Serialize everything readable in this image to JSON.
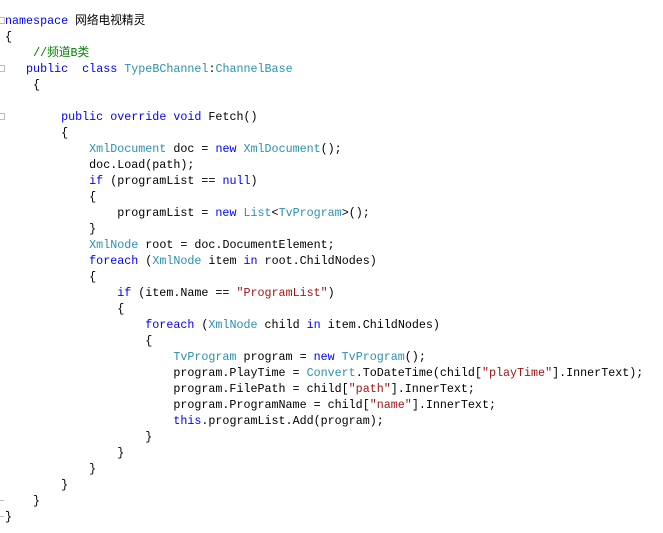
{
  "colors": {
    "keyword": "#0000ff",
    "type": "#2b91af",
    "string": "#a31515",
    "comment": "#008000",
    "text": "#000000"
  },
  "code_lines": [
    {
      "fold": "start",
      "tokens": [
        [
          "kw",
          "namespace"
        ],
        [
          "tx",
          " 网络电视精灵"
        ]
      ]
    },
    {
      "tokens": [
        [
          "tx",
          "{"
        ]
      ]
    },
    {
      "tokens": [
        [
          "tx",
          "    "
        ],
        [
          "cm",
          "//频道B类"
        ]
      ]
    },
    {
      "fold": "start",
      "tokens": [
        [
          "tx",
          "   "
        ],
        [
          "kw",
          "public"
        ],
        [
          "tx",
          "  "
        ],
        [
          "kw",
          "class"
        ],
        [
          "tx",
          " "
        ],
        [
          "ty",
          "TypeBChannel"
        ],
        [
          "tx",
          ":"
        ],
        [
          "ty",
          "ChannelBase"
        ]
      ]
    },
    {
      "tokens": [
        [
          "tx",
          "    {"
        ]
      ]
    },
    {
      "tokens": []
    },
    {
      "fold": "start",
      "tokens": [
        [
          "tx",
          "        "
        ],
        [
          "kw",
          "public"
        ],
        [
          "tx",
          " "
        ],
        [
          "kw",
          "override"
        ],
        [
          "tx",
          " "
        ],
        [
          "kw",
          "void"
        ],
        [
          "tx",
          " Fetch()"
        ]
      ]
    },
    {
      "tokens": [
        [
          "tx",
          "        {"
        ]
      ]
    },
    {
      "tokens": [
        [
          "tx",
          "            "
        ],
        [
          "ty",
          "XmlDocument"
        ],
        [
          "tx",
          " doc = "
        ],
        [
          "kw",
          "new"
        ],
        [
          "tx",
          " "
        ],
        [
          "ty",
          "XmlDocument"
        ],
        [
          "tx",
          "();"
        ]
      ]
    },
    {
      "tokens": [
        [
          "tx",
          "            doc.Load(path);"
        ]
      ]
    },
    {
      "tokens": [
        [
          "tx",
          "            "
        ],
        [
          "kw",
          "if"
        ],
        [
          "tx",
          " (programList == "
        ],
        [
          "kw",
          "null"
        ],
        [
          "tx",
          ")"
        ]
      ]
    },
    {
      "tokens": [
        [
          "tx",
          "            {"
        ]
      ]
    },
    {
      "tokens": [
        [
          "tx",
          "                programList = "
        ],
        [
          "kw",
          "new"
        ],
        [
          "tx",
          " "
        ],
        [
          "ty",
          "List"
        ],
        [
          "tx",
          "<"
        ],
        [
          "ty",
          "TvProgram"
        ],
        [
          "tx",
          ">();"
        ]
      ]
    },
    {
      "tokens": [
        [
          "tx",
          "            }"
        ]
      ]
    },
    {
      "tokens": [
        [
          "tx",
          "            "
        ],
        [
          "ty",
          "XmlNode"
        ],
        [
          "tx",
          " root = doc.DocumentElement;"
        ]
      ]
    },
    {
      "tokens": [
        [
          "tx",
          "            "
        ],
        [
          "kw",
          "foreach"
        ],
        [
          "tx",
          " ("
        ],
        [
          "ty",
          "XmlNode"
        ],
        [
          "tx",
          " item "
        ],
        [
          "kw",
          "in"
        ],
        [
          "tx",
          " root.ChildNodes)"
        ]
      ]
    },
    {
      "tokens": [
        [
          "tx",
          "            {"
        ]
      ]
    },
    {
      "tokens": [
        [
          "tx",
          "                "
        ],
        [
          "kw",
          "if"
        ],
        [
          "tx",
          " (item.Name == "
        ],
        [
          "st",
          "\"ProgramList\""
        ],
        [
          "tx",
          ")"
        ]
      ]
    },
    {
      "tokens": [
        [
          "tx",
          "                {"
        ]
      ]
    },
    {
      "tokens": [
        [
          "tx",
          "                    "
        ],
        [
          "kw",
          "foreach"
        ],
        [
          "tx",
          " ("
        ],
        [
          "ty",
          "XmlNode"
        ],
        [
          "tx",
          " child "
        ],
        [
          "kw",
          "in"
        ],
        [
          "tx",
          " item.ChildNodes)"
        ]
      ]
    },
    {
      "tokens": [
        [
          "tx",
          "                    {"
        ]
      ]
    },
    {
      "tokens": [
        [
          "tx",
          "                        "
        ],
        [
          "ty",
          "TvProgram"
        ],
        [
          "tx",
          " program = "
        ],
        [
          "kw",
          "new"
        ],
        [
          "tx",
          " "
        ],
        [
          "ty",
          "TvProgram"
        ],
        [
          "tx",
          "();"
        ]
      ]
    },
    {
      "tokens": [
        [
          "tx",
          "                        program.PlayTime = "
        ],
        [
          "ty",
          "Convert"
        ],
        [
          "tx",
          ".ToDateTime(child["
        ],
        [
          "st",
          "\"playTime\""
        ],
        [
          "tx",
          "].InnerText);"
        ]
      ]
    },
    {
      "tokens": [
        [
          "tx",
          "                        program.FilePath = child["
        ],
        [
          "st",
          "\"path\""
        ],
        [
          "tx",
          "].InnerText;"
        ]
      ]
    },
    {
      "tokens": [
        [
          "tx",
          "                        program.ProgramName = child["
        ],
        [
          "st",
          "\"name\""
        ],
        [
          "tx",
          "].InnerText;"
        ]
      ]
    },
    {
      "tokens": [
        [
          "tx",
          "                        "
        ],
        [
          "kw",
          "this"
        ],
        [
          "tx",
          ".programList.Add(program);"
        ]
      ]
    },
    {
      "tokens": [
        [
          "tx",
          "                    }"
        ]
      ]
    },
    {
      "tokens": [
        [
          "tx",
          "                }"
        ]
      ]
    },
    {
      "tokens": [
        [
          "tx",
          "            }"
        ]
      ]
    },
    {
      "tokens": [
        [
          "tx",
          "        }"
        ]
      ]
    },
    {
      "fold": "end",
      "tokens": [
        [
          "tx",
          "    }"
        ]
      ]
    },
    {
      "fold": "end",
      "tokens": [
        [
          "tx",
          "}"
        ]
      ]
    }
  ]
}
